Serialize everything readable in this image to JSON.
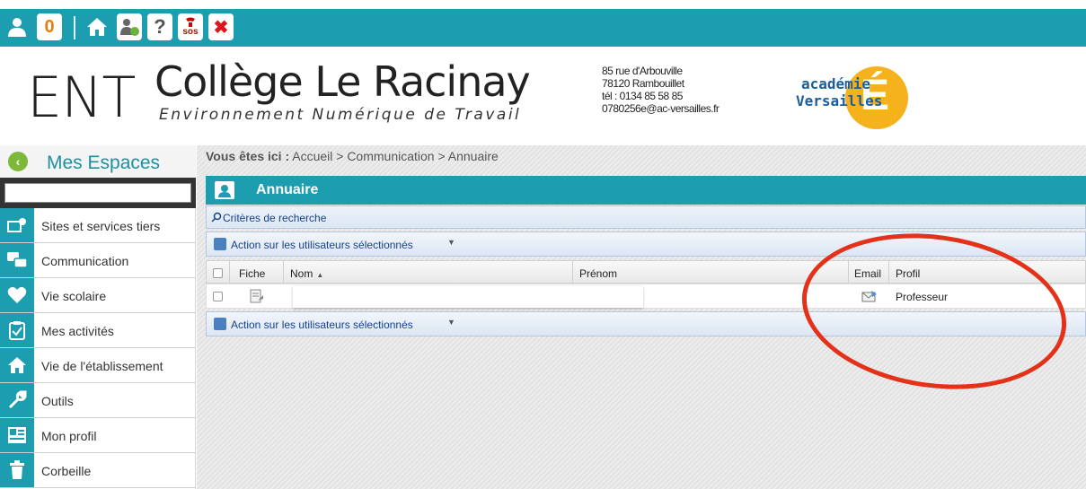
{
  "topbar": {
    "icons": [
      "user-icon",
      "notification-badge",
      "home-icon",
      "users-config-icon",
      "help-icon",
      "sos-phone-icon",
      "close-icon"
    ],
    "notification_count": "0",
    "help_symbol": "?",
    "sos_label": "sos",
    "close_symbol": "✖",
    "accent_color": "#1d9db0"
  },
  "header": {
    "ent": "ENT",
    "college_name": "Collège Le Racinay",
    "subtitle": "Environnement Numérique de Travail",
    "address_line1": "85 rue d'Arbouville",
    "address_line2": "78120 Rambouillet",
    "address_line3": "tél : 0134 85 58 85",
    "address_line4": "0780256e@ac-versailles.fr",
    "logo_line1": "académie",
    "logo_line2": "Versailles",
    "logo_letter": "É"
  },
  "sidebar": {
    "title": "Mes Espaces",
    "search_value": "",
    "items": [
      {
        "label": "Sites et services tiers",
        "icon": "external-sites-icon"
      },
      {
        "label": "Communication",
        "icon": "chat-bubbles-icon"
      },
      {
        "label": "Vie scolaire",
        "icon": "heart-icon"
      },
      {
        "label": "Mes activités",
        "icon": "clipboard-icon"
      },
      {
        "label": "Vie de l'établissement",
        "icon": "home-icon"
      },
      {
        "label": "Outils",
        "icon": "wrench-icon"
      },
      {
        "label": "Mon profil",
        "icon": "profile-card-icon"
      },
      {
        "label": "Corbeille",
        "icon": "trash-icon"
      }
    ]
  },
  "breadcrumb": {
    "prefix": "Vous êtes ici :",
    "path": "Accueil > Communication > Annuaire"
  },
  "panel": {
    "title": "Annuaire",
    "criteria_label": "Critères de recherche",
    "action_label": "Action sur les utilisateurs sélectionnés",
    "columns": [
      "Fiche",
      "Nom",
      "Prénom",
      "Email",
      "Profil"
    ],
    "rows": [
      {
        "nom": "",
        "prenom": "",
        "profil": "Professeur"
      }
    ]
  },
  "annotation": {
    "ellipse_color": "#e4321a"
  }
}
